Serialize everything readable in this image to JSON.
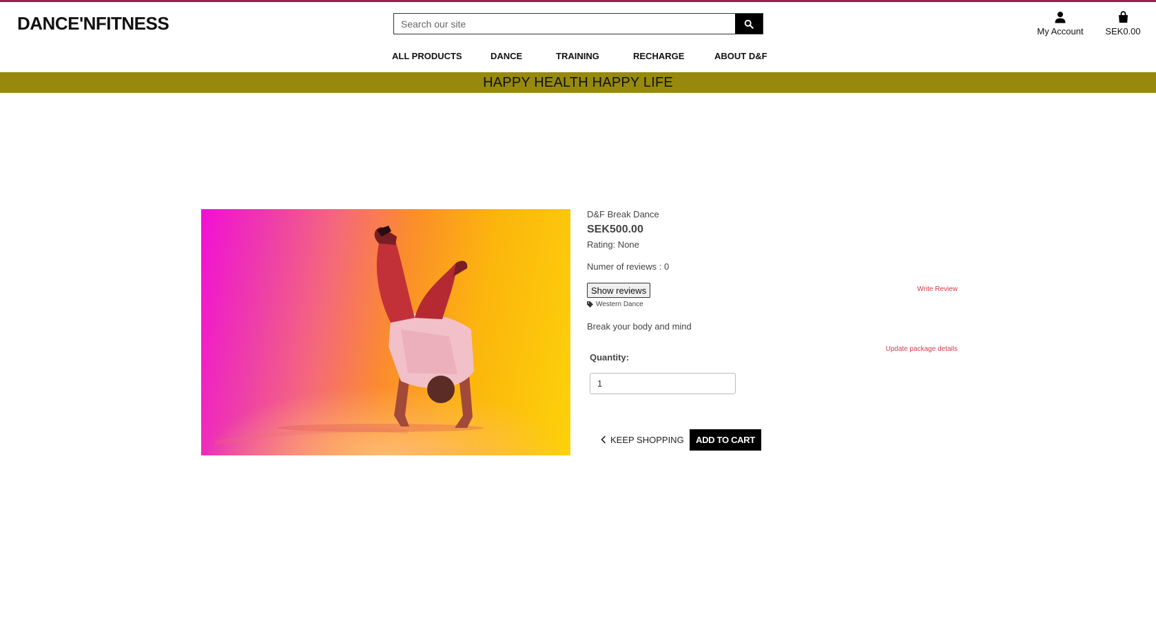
{
  "header": {
    "logo": "DANCE'NFITNESS",
    "search_placeholder": "Search our site",
    "account_label": "My Account",
    "cart_total": "SEK0.00"
  },
  "nav": {
    "items": [
      {
        "label": "ALL PRODUCTS"
      },
      {
        "label": "DANCE"
      },
      {
        "label": "TRAINING"
      },
      {
        "label": "RECHARGE"
      },
      {
        "label": "ABOUT D&F"
      }
    ]
  },
  "banner": {
    "text": "HAPPY HEALTH HAPPY LIFE"
  },
  "product": {
    "name": "D&F Break Dance",
    "price": "SEK500.00",
    "rating": "Rating: None",
    "reviews_count": "Numer of reviews : 0",
    "show_reviews_label": "Show reviews",
    "write_review_label": "Write Review",
    "category_tag": "Western Dance",
    "description": "Break your body and mind",
    "update_package_label": "Update package details",
    "quantity_label": "Quantity:",
    "quantity_value": "1",
    "keep_shopping_label": "KEEP SHOPPING",
    "add_to_cart_label": "ADD TO CART"
  },
  "colors": {
    "brand_strip": "#a0204f",
    "banner_bg": "#96890c",
    "link_red": "#d33a4a",
    "button_black": "#000000"
  },
  "icons": {
    "search": "search-icon",
    "account": "user-icon",
    "cart": "shopping-bag-icon",
    "tag": "tag-icon",
    "back": "chevron-left-icon"
  }
}
